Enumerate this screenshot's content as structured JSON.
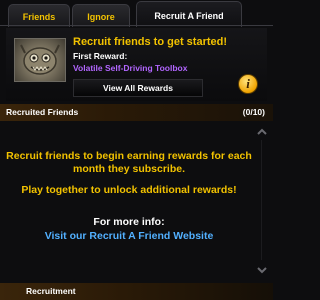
{
  "tabs": [
    {
      "label": "Friends"
    },
    {
      "label": "Ignore"
    },
    {
      "label": "Recruit A Friend"
    }
  ],
  "active_tab": "Recruit A Friend",
  "reward": {
    "headline": "Recruit friends to get started!",
    "first_reward_label": "First Reward:",
    "first_reward_name": "Volatile Self-Driving Toolbox",
    "view_all_button": "View All Rewards",
    "portrait_icon": "toolbox-creature-icon",
    "info_icon": "info-icon",
    "info_glyph": "i"
  },
  "recruited": {
    "title": "Recruited Friends",
    "count": "(0/10)"
  },
  "content": {
    "message_1": "Recruit friends to begin earning rewards for each month they subscribe.",
    "message_2": "Play together to unlock additional rewards!",
    "more_info": "For more info:",
    "website_link": "Visit our Recruit A Friend Website"
  },
  "bottom_bar": {
    "label": "Recruitment"
  },
  "colors": {
    "gold": "#f2c200",
    "purple": "#b266ff",
    "link_blue": "#52b0ff",
    "header_bar": "#3a250b"
  }
}
